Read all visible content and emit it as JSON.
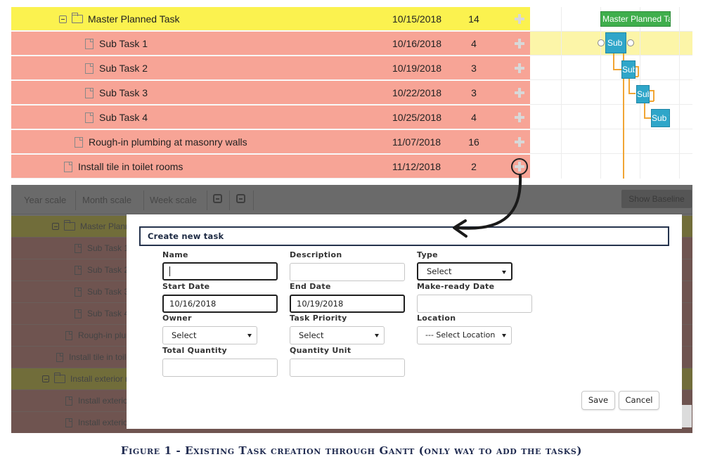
{
  "top_grid": {
    "rows": [
      {
        "name": "Master Planned Task",
        "date": "10/15/2018",
        "duration": "14"
      },
      {
        "name": "Sub Task 1",
        "date": "10/16/2018",
        "duration": "4"
      },
      {
        "name": "Sub Task 2",
        "date": "10/19/2018",
        "duration": "3"
      },
      {
        "name": "Sub Task 3",
        "date": "10/22/2018",
        "duration": "3"
      },
      {
        "name": "Sub Task 4",
        "date": "10/25/2018",
        "duration": "4"
      },
      {
        "name": "Rough-in plumbing at masonry walls",
        "date": "11/07/2018",
        "duration": "16"
      },
      {
        "name": "Install tile in toilet rooms",
        "date": "11/12/2018",
        "duration": "2"
      }
    ]
  },
  "top_gantt": {
    "bars": [
      "Master Planned Ta",
      "Sub",
      "Sub",
      "Sub",
      "Sub T"
    ]
  },
  "toolbar": {
    "year_scale": "Year scale",
    "month_scale": "Month scale",
    "week_scale": "Week scale",
    "show_baseline": "Show Baseline"
  },
  "background_rows": [
    "Master Planne",
    "Sub Task 1",
    "Sub Task 2",
    "Sub Task 3",
    "Sub Task 4",
    "Rough-in plun",
    "Install tile in toile",
    "Install exterior m",
    "Install exterio",
    "Install exterio"
  ],
  "modal": {
    "title": "Create new task",
    "name_label": "Name",
    "name_value": "",
    "description_label": "Description",
    "description_value": "",
    "type_label": "Type",
    "type_value": "Select",
    "start_date_label": "Start Date",
    "start_date_value": "10/16/2018",
    "end_date_label": "End Date",
    "end_date_value": "10/19/2018",
    "make_ready_label": "Make-ready Date",
    "make_ready_value": "",
    "owner_label": "Owner",
    "owner_value": "Select",
    "priority_label": "Task Priority",
    "priority_value": "Select",
    "location_label": "Location",
    "location_value": "--- Select Location",
    "total_qty_label": "Total Quantity",
    "total_qty_value": "",
    "qty_unit_label": "Quantity Unit",
    "qty_unit_value": "",
    "save_label": "Save",
    "cancel_label": "Cancel"
  },
  "caption": "Figure 1 - Existing Task creation through Gantt (only way to add the tasks)",
  "colors": {
    "master_row": "#fbf24f",
    "task_row": "#f7a496",
    "gantt_master_bar": "#3fae4c",
    "gantt_task_bar": "#2fa6c9",
    "gantt_link": "#f1a534",
    "caption": "#1f2a4f"
  }
}
